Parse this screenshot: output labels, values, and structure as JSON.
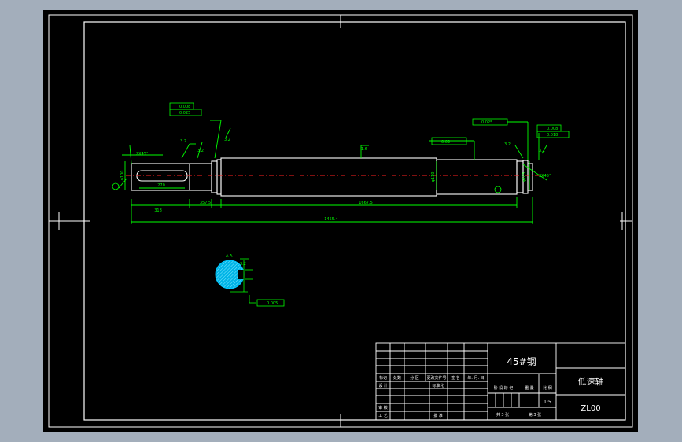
{
  "shaft": {
    "material_mark": "45#",
    "dims": {
      "left_step": "318",
      "key_len": "270",
      "mid_len": "1667.5",
      "total_len": "1455.4",
      "left_ring": "357.5",
      "d1": "φ100",
      "d2": "φ110",
      "d3": "φ105",
      "chamfer_l": "2X45°",
      "chamfer_r": "2X45°"
    },
    "tolerances": {
      "left_1": "0.008",
      "left_2": "0.025",
      "right_1": "0.008",
      "right_2": "0.018",
      "mid": "0.02",
      "right_top": "0.025",
      "section": "0.005"
    },
    "roughness": [
      "3.2",
      "3.2",
      "3.2",
      "1.6",
      "3.2",
      "3.2",
      "3.2"
    ],
    "section_label": "A-A"
  },
  "title_block": {
    "material": "45#钢",
    "part_name": "低速轴",
    "drawing_no": "ZL00",
    "scale": "1:5",
    "headers": [
      "标记",
      "处数",
      "分 区",
      "更改文件号",
      "签 名",
      "年. 月. 日"
    ],
    "rows": [
      "设 计",
      "审 核",
      "工 艺"
    ],
    "standardize": "标准化",
    "approve": "批 准",
    "stage_labels": [
      "阶 段 标 记",
      "重 量",
      "比 例"
    ],
    "sheet_total": "共 3 张",
    "sheet_no": "第 3 张"
  },
  "colors": {
    "background": "#a3aebb",
    "paper": "#000000",
    "outline": "#ffffff",
    "dimension": "#00ff00",
    "centerline": "#ff0000",
    "hatch": "#00c8ff"
  }
}
